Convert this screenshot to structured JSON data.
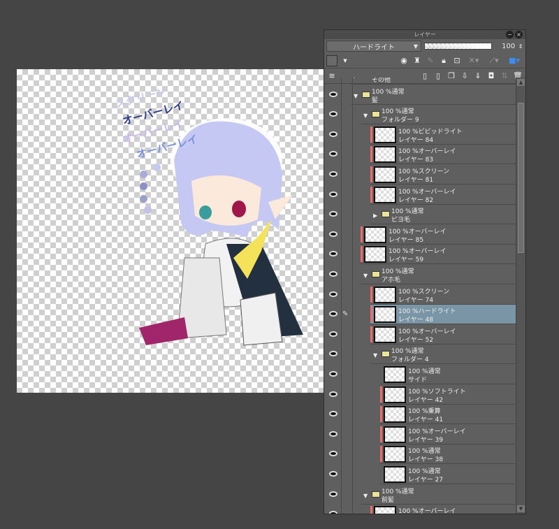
{
  "canvas": {
    "notes": [
      "スクリーン",
      "オーバーレイ",
      "オーバーレイ",
      "オーバーレイ"
    ],
    "note_colors": [
      "#c8ccf0",
      "#2a3a8a",
      "#c9b8f0",
      "#7a90e0"
    ],
    "swatches": [
      "#c8c9ef",
      "#a9acd9",
      "#8d90c8",
      "#9c9fc7",
      "#c2c3e6"
    ]
  },
  "panel": {
    "title": "レイヤー",
    "blend_mode": "ハードライト",
    "opacity": "100",
    "opacity_fraction": 1.0,
    "layers": [
      {
        "level": 0,
        "type": "folder",
        "open": false,
        "line1": "",
        "line2": "その他",
        "partial": true
      },
      {
        "level": 0,
        "type": "folder",
        "open": true,
        "line1": "100 %通常",
        "line2": "髪"
      },
      {
        "level": 1,
        "type": "folder",
        "open": true,
        "line1": "100 %通常",
        "line2": "フォルダー 9"
      },
      {
        "level": 2,
        "type": "layer",
        "red": true,
        "line1": "100 %ビビッドライト",
        "line2": "レイヤー 84"
      },
      {
        "level": 2,
        "type": "layer",
        "red": true,
        "line1": "100 %オーバーレイ",
        "line2": "レイヤー 83"
      },
      {
        "level": 2,
        "type": "layer",
        "red": true,
        "line1": "100 %スクリーン",
        "line2": "レイヤー 81"
      },
      {
        "level": 2,
        "type": "layer",
        "red": true,
        "line1": "100 %オーバーレイ",
        "line2": "レイヤー 82"
      },
      {
        "level": 2,
        "type": "folder",
        "open": false,
        "line1": "100 %通常",
        "line2": "ピヨ毛"
      },
      {
        "level": 1,
        "type": "layer",
        "red": true,
        "line1": "100 %オーバーレイ",
        "line2": "レイヤー 85"
      },
      {
        "level": 1,
        "type": "layer",
        "red": true,
        "line1": "100 %オーバーレイ",
        "line2": "レイヤー 59"
      },
      {
        "level": 1,
        "type": "folder",
        "open": true,
        "line1": "100 %通常",
        "line2": "アホ毛"
      },
      {
        "level": 2,
        "type": "layer",
        "red": true,
        "line1": "100 %スクリーン",
        "line2": "レイヤー 74"
      },
      {
        "level": 2,
        "type": "layer",
        "red": true,
        "selected": true,
        "line1": "100 %ハードライト",
        "line2": "レイヤー 48"
      },
      {
        "level": 2,
        "type": "layer",
        "red": true,
        "line1": "100 %オーバーレイ",
        "line2": "レイヤー 52"
      },
      {
        "level": 2,
        "type": "folder",
        "open": true,
        "line1": "100 %通常",
        "line2": "フォルダー 4"
      },
      {
        "level": 3,
        "type": "layer",
        "red": false,
        "line1": "100 %通常",
        "line2": "サイド"
      },
      {
        "level": 3,
        "type": "layer",
        "red": true,
        "line1": "100 %ソフトライト",
        "line2": "レイヤー 42"
      },
      {
        "level": 3,
        "type": "layer",
        "red": true,
        "line1": "100 %乗算",
        "line2": "レイヤー 41"
      },
      {
        "level": 3,
        "type": "layer",
        "red": true,
        "line1": "100 %オーバーレイ",
        "line2": "レイヤー 39"
      },
      {
        "level": 3,
        "type": "layer",
        "red": true,
        "line1": "100 %通常",
        "line2": "レイヤー 38"
      },
      {
        "level": 3,
        "type": "layer",
        "red": false,
        "line1": "100 %通常",
        "line2": "レイヤー 27"
      },
      {
        "level": 1,
        "type": "folder",
        "open": true,
        "line1": "100 %通常",
        "line2": "前髪"
      },
      {
        "level": 2,
        "type": "layer",
        "red": true,
        "line1": "100 %オーバーレイ",
        "line2": ""
      }
    ]
  }
}
